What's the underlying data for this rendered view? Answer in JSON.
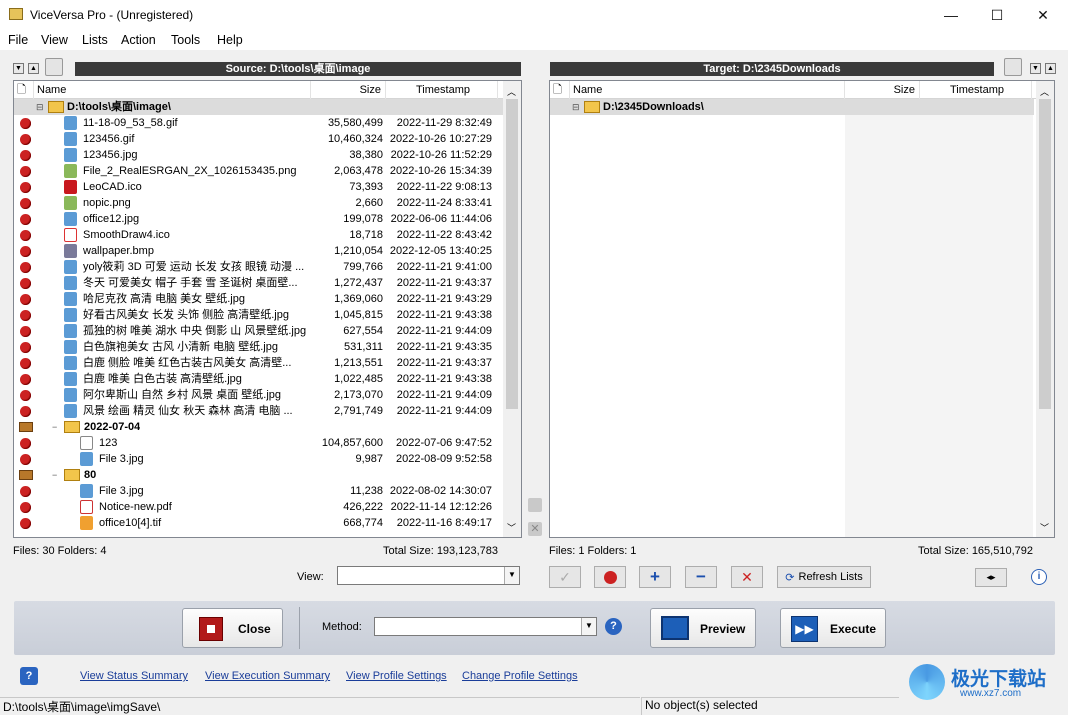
{
  "window": {
    "title": "ViceVersa Pro - (Unregistered)",
    "minimize": "—",
    "maximize": "☐",
    "close": "✕"
  },
  "menu": [
    "File",
    "View",
    "Lists",
    "Action",
    "Tools",
    "Help"
  ],
  "source": {
    "header": "Source: D:\\tools\\桌面\\image",
    "columns": {
      "name": "Name",
      "size": "Size",
      "timestamp": "Timestamp"
    },
    "root": "D:\\tools\\桌面\\image\\",
    "files": [
      {
        "name": "11-18-09_53_58.gif",
        "size": "35,580,499",
        "ts": "2022-11-29 8:32:49",
        "icon": "gif"
      },
      {
        "name": "123456.gif",
        "size": "10,460,324",
        "ts": "2022-10-26 10:27:29",
        "icon": "gif"
      },
      {
        "name": "123456.jpg",
        "size": "38,380",
        "ts": "2022-10-26 11:52:29",
        "icon": "jpg"
      },
      {
        "name": "File_2_RealESRGAN_2X_1026153435.png",
        "size": "2,063,478",
        "ts": "2022-10-26 15:34:39",
        "icon": "png"
      },
      {
        "name": "LeoCAD.ico",
        "size": "73,393",
        "ts": "2022-11-22 9:08:13",
        "icon": "ico"
      },
      {
        "name": "nopic.png",
        "size": "2,660",
        "ts": "2022-11-24 8:33:41",
        "icon": "png"
      },
      {
        "name": "office12.jpg",
        "size": "199,078",
        "ts": "2022-06-06 11:44:06",
        "icon": "jpg"
      },
      {
        "name": "SmoothDraw4.ico",
        "size": "18,718",
        "ts": "2022-11-22 8:43:42",
        "icon": "sd"
      },
      {
        "name": "wallpaper.bmp",
        "size": "1,210,054",
        "ts": "2022-12-05 13:40:25",
        "icon": "bmp"
      },
      {
        "name": "yoly筱莉 3D 可爱 运动 长发 女孩 眼镜 动漫 ...",
        "size": "799,766",
        "ts": "2022-11-21 9:41:00",
        "icon": "jpg"
      },
      {
        "name": "冬天 可爱美女 帽子 手套 雪 圣诞树 桌面壁...",
        "size": "1,272,437",
        "ts": "2022-11-21 9:43:37",
        "icon": "jpg"
      },
      {
        "name": "哈尼克孜 高清 电脑 美女 壁纸.jpg",
        "size": "1,369,060",
        "ts": "2022-11-21 9:43:29",
        "icon": "jpg"
      },
      {
        "name": "好看古风美女 长发 头饰 侧脸 高清壁纸.jpg",
        "size": "1,045,815",
        "ts": "2022-11-21 9:43:38",
        "icon": "jpg"
      },
      {
        "name": "孤独的树 唯美 湖水 中央 倒影 山 风景壁纸.jpg",
        "size": "627,554",
        "ts": "2022-11-21 9:44:09",
        "icon": "jpg"
      },
      {
        "name": "白色旗袍美女 古风 小清新 电脑 壁纸.jpg",
        "size": "531,311",
        "ts": "2022-11-21 9:43:35",
        "icon": "jpg"
      },
      {
        "name": "白鹿 侧脸 唯美 红色古装古风美女 高清壁...",
        "size": "1,213,551",
        "ts": "2022-11-21 9:43:37",
        "icon": "jpg"
      },
      {
        "name": "白鹿 唯美 白色古装 高清壁纸.jpg",
        "size": "1,022,485",
        "ts": "2022-11-21 9:43:38",
        "icon": "jpg"
      },
      {
        "name": "阿尔卑斯山 自然 乡村 风景 桌面 壁纸.jpg",
        "size": "2,173,070",
        "ts": "2022-11-21 9:44:09",
        "icon": "jpg"
      },
      {
        "name": "风景 绘画 精灵 仙女 秋天 森林 高清 电脑 ...",
        "size": "2,791,749",
        "ts": "2022-11-21 9:44:09",
        "icon": "jpg"
      }
    ],
    "folder1": {
      "name": "2022-07-04",
      "files": [
        {
          "name": "123",
          "size": "104,857,600",
          "ts": "2022-07-06 9:47:52",
          "icon": "txt"
        },
        {
          "name": "File 3.jpg",
          "size": "9,987",
          "ts": "2022-08-09 9:52:58",
          "icon": "jpg"
        }
      ]
    },
    "folder2": {
      "name": "80",
      "files": [
        {
          "name": "File 3.jpg",
          "size": "11,238",
          "ts": "2022-08-02 14:30:07",
          "icon": "jpg"
        },
        {
          "name": "Notice-new.pdf",
          "size": "426,222",
          "ts": "2022-11-14 12:12:26",
          "icon": "pdf"
        },
        {
          "name": "office10[4].tif",
          "size": "668,774",
          "ts": "2022-11-16 8:49:17",
          "icon": "tif"
        }
      ]
    },
    "summary_left": "Files: 30  Folders: 4",
    "summary_right": "Total Size: 193,123,783"
  },
  "target": {
    "header": "Target: D:\\2345Downloads",
    "columns": {
      "name": "Name",
      "size": "Size",
      "timestamp": "Timestamp"
    },
    "root": "D:\\2345Downloads\\",
    "summary_left": "Files: 1  Folders: 1",
    "summary_right": "Total Size: 165,510,792"
  },
  "controls": {
    "view_label": "View:",
    "refresh": "Refresh Lists",
    "method_label": "Method:"
  },
  "actions": {
    "close": "Close",
    "preview": "Preview",
    "execute": "Execute"
  },
  "links": [
    "View Status Summary",
    "View Execution Summary",
    "View Profile Settings",
    "Change Profile Settings"
  ],
  "status": {
    "path": "D:\\tools\\桌面\\image\\imgSave\\",
    "selection": "No object(s) selected"
  },
  "watermark": "极光下载站",
  "watermark_url": "www.xz7.com"
}
